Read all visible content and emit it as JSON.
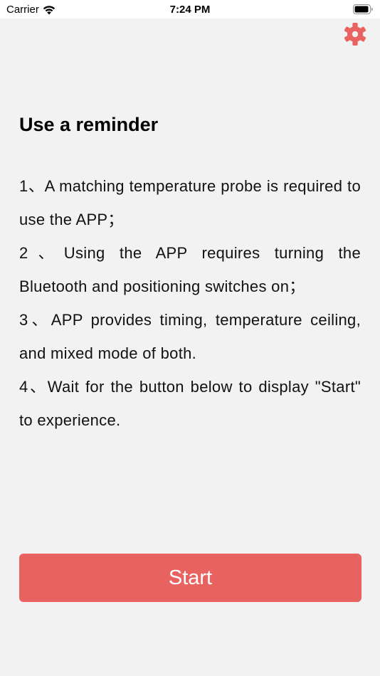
{
  "status_bar": {
    "carrier": "Carrier",
    "time": "7:24 PM",
    "icons": [
      "wifi-icon",
      "battery-icon"
    ]
  },
  "header": {
    "settings_icon": "gear-icon",
    "accent_color": "#e8625f"
  },
  "main": {
    "title": "Use a reminder",
    "items": [
      {
        "text": "1、A matching temperature probe is required to use the APP；"
      },
      {
        "text": "2、Using the APP requires turning the Bluetooth and positioning switches on；"
      },
      {
        "text": "3、APP provides timing, temperature ceiling, and mixed mode of both."
      },
      {
        "text": "4、Wait for the button below to display \"Start\" to experience."
      }
    ]
  },
  "actions": {
    "start_label": "Start",
    "button_color": "#e8625f"
  }
}
